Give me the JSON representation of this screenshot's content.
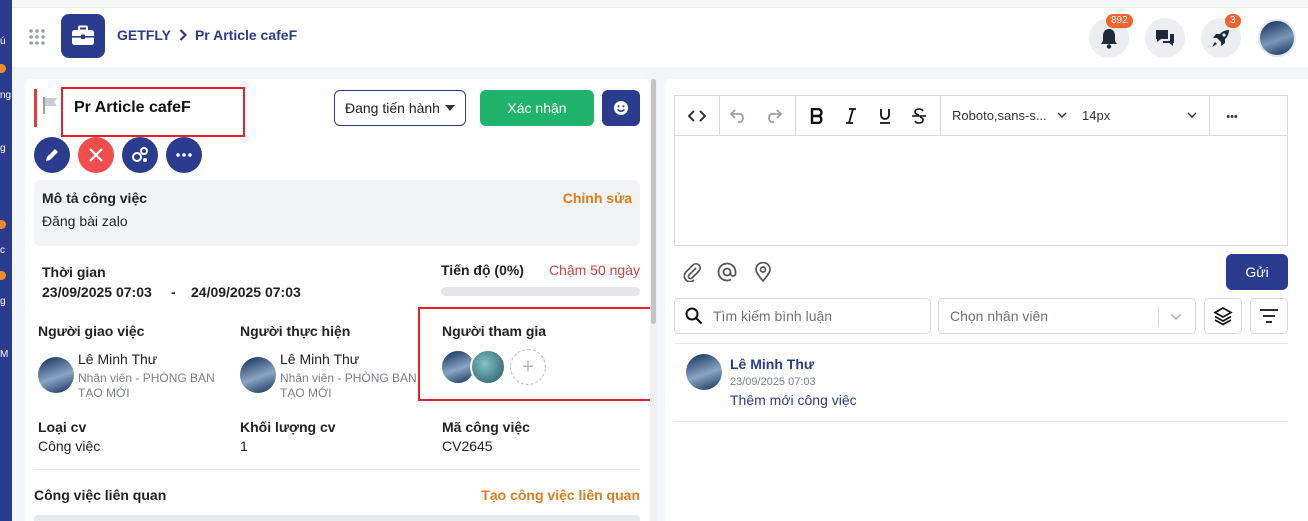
{
  "sidebar": {
    "fragments": [
      "ú",
      "ng",
      "g",
      "c",
      "g",
      "M"
    ]
  },
  "topbar": {
    "breadcrumb_root": "GETFLY",
    "breadcrumb_current": "Pr Article cafeF",
    "notifications_badge": "892",
    "rocket_badge": "3"
  },
  "task": {
    "title": "Pr Article cafeF",
    "status": "Đang tiến hành",
    "confirm_label": "Xác nhận",
    "description_label": "Mô tả công việc",
    "description_edit": "Chỉnh sửa",
    "description_text": "Đăng bài zalo",
    "time_label": "Thời gian",
    "start_time": "23/09/2025 07:03",
    "time_separator": "-",
    "end_time": "24/09/2025 07:03",
    "progress_label": "Tiến độ (0%)",
    "progress_value": 0,
    "late_label": "Chậm 50 ngày",
    "assigner_label": "Người giao việc",
    "assigner_name": "Lê Minh Thư",
    "assigner_role": "Nhân viên - PHÒNG BAN TẠO MỚI",
    "executor_label": "Người thực hiện",
    "executor_name": "Lê Minh Thư",
    "executor_role": "Nhân viên - PHÒNG BAN TẠO MỚI",
    "participants_label": "Người tham gia",
    "add_participant": "+",
    "type_label": "Loại cv",
    "type_value": "Công việc",
    "volume_label": "Khối lượng cv",
    "volume_value": "1",
    "code_label": "Mã công việc",
    "code_value": "CV2645",
    "related_label": "Công việc liên quan",
    "related_create": "Tạo công việc liên quan"
  },
  "editor": {
    "font": "Roboto,sans-s...",
    "font_size": "14px",
    "more": "•••",
    "send_label": "Gửi"
  },
  "comments": {
    "search_placeholder": "Tìm kiếm bình luận",
    "employee_placeholder": "Chọn nhân viên",
    "items": [
      {
        "name": "Lê Minh Thư",
        "time": "23/09/2025 07:03",
        "text": "Thêm mới công việc"
      }
    ]
  },
  "colors": {
    "brand": "#2b3c8f",
    "success": "#1fb36b",
    "accent_orange": "#e07b1a",
    "danger": "#e3202e"
  }
}
